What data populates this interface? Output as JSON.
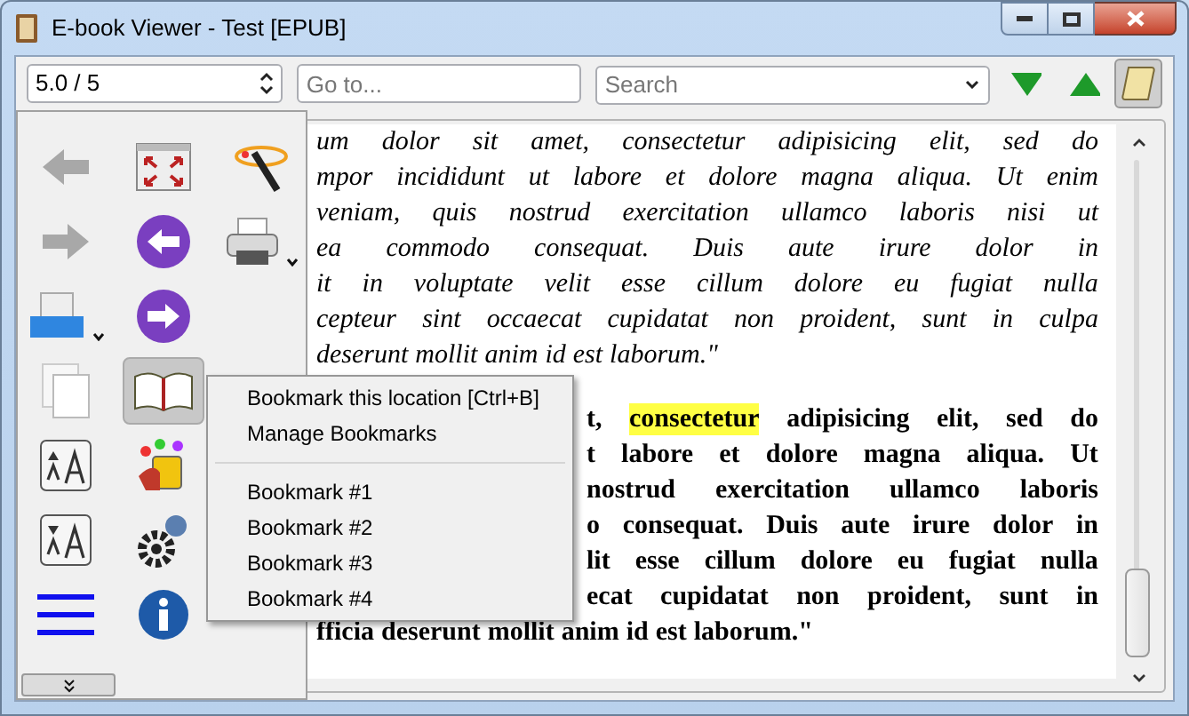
{
  "window": {
    "title": "E-book Viewer - Test [EPUB]"
  },
  "toolbar": {
    "position": "5.0 / 5",
    "goto": {
      "placeholder": "Go to..."
    },
    "search": {
      "placeholder": "Search"
    }
  },
  "document": {
    "paragraphs": [
      {
        "kind": "italic",
        "lines": [
          [
            {
              "text": "um dolor sit amet, consectetur adipisicing elit, sed do"
            }
          ],
          [
            {
              "text": "mpor incididunt ut labore et dolore magna aliqua. Ut enim"
            }
          ],
          [
            {
              "text": "veniam, quis nostrud exercitation ullamco laboris nisi ut"
            }
          ],
          [
            {
              "text": "ea commodo consequat. Duis aute irure dolor in"
            }
          ],
          [
            {
              "text": "it in voluptate velit esse cillum dolore eu fugiat nulla"
            }
          ],
          [
            {
              "text": "cepteur sint occaecat cupidatat non proident, sunt in culpa"
            }
          ],
          [
            {
              "text": "deserunt mollit anim id est laborum.\""
            }
          ]
        ]
      },
      {
        "kind": "bold",
        "lines": [
          [
            {
              "text": "t,"
            },
            {
              "text": "consectetur",
              "highlighted": true
            },
            {
              "text": "adipisicing elit, sed do"
            }
          ],
          [
            {
              "text": "t labore et dolore magna aliqua. Ut"
            }
          ],
          [
            {
              "text": "nostrud exercitation ullamco laboris"
            }
          ],
          [
            {
              "text": "o consequat. Duis aute irure dolor in"
            }
          ],
          [
            {
              "text": "lit esse cillum dolore eu fugiat nulla"
            }
          ],
          [
            {
              "text": "ecat cupidatat non proident, sunt in"
            }
          ],
          [
            {
              "text": "fficia deserunt mollit anim id est laborum.\""
            }
          ]
        ]
      }
    ]
  },
  "bookmark_menu": [
    {
      "kind": "item",
      "label": "Bookmark this location [Ctrl+B]"
    },
    {
      "kind": "item",
      "label": "Manage Bookmarks"
    },
    {
      "kind": "separator"
    },
    {
      "kind": "item",
      "label": "Bookmark #1"
    },
    {
      "kind": "item",
      "label": "Bookmark #2"
    },
    {
      "kind": "item",
      "label": "Bookmark #3"
    },
    {
      "kind": "item",
      "label": "Bookmark #4"
    }
  ]
}
